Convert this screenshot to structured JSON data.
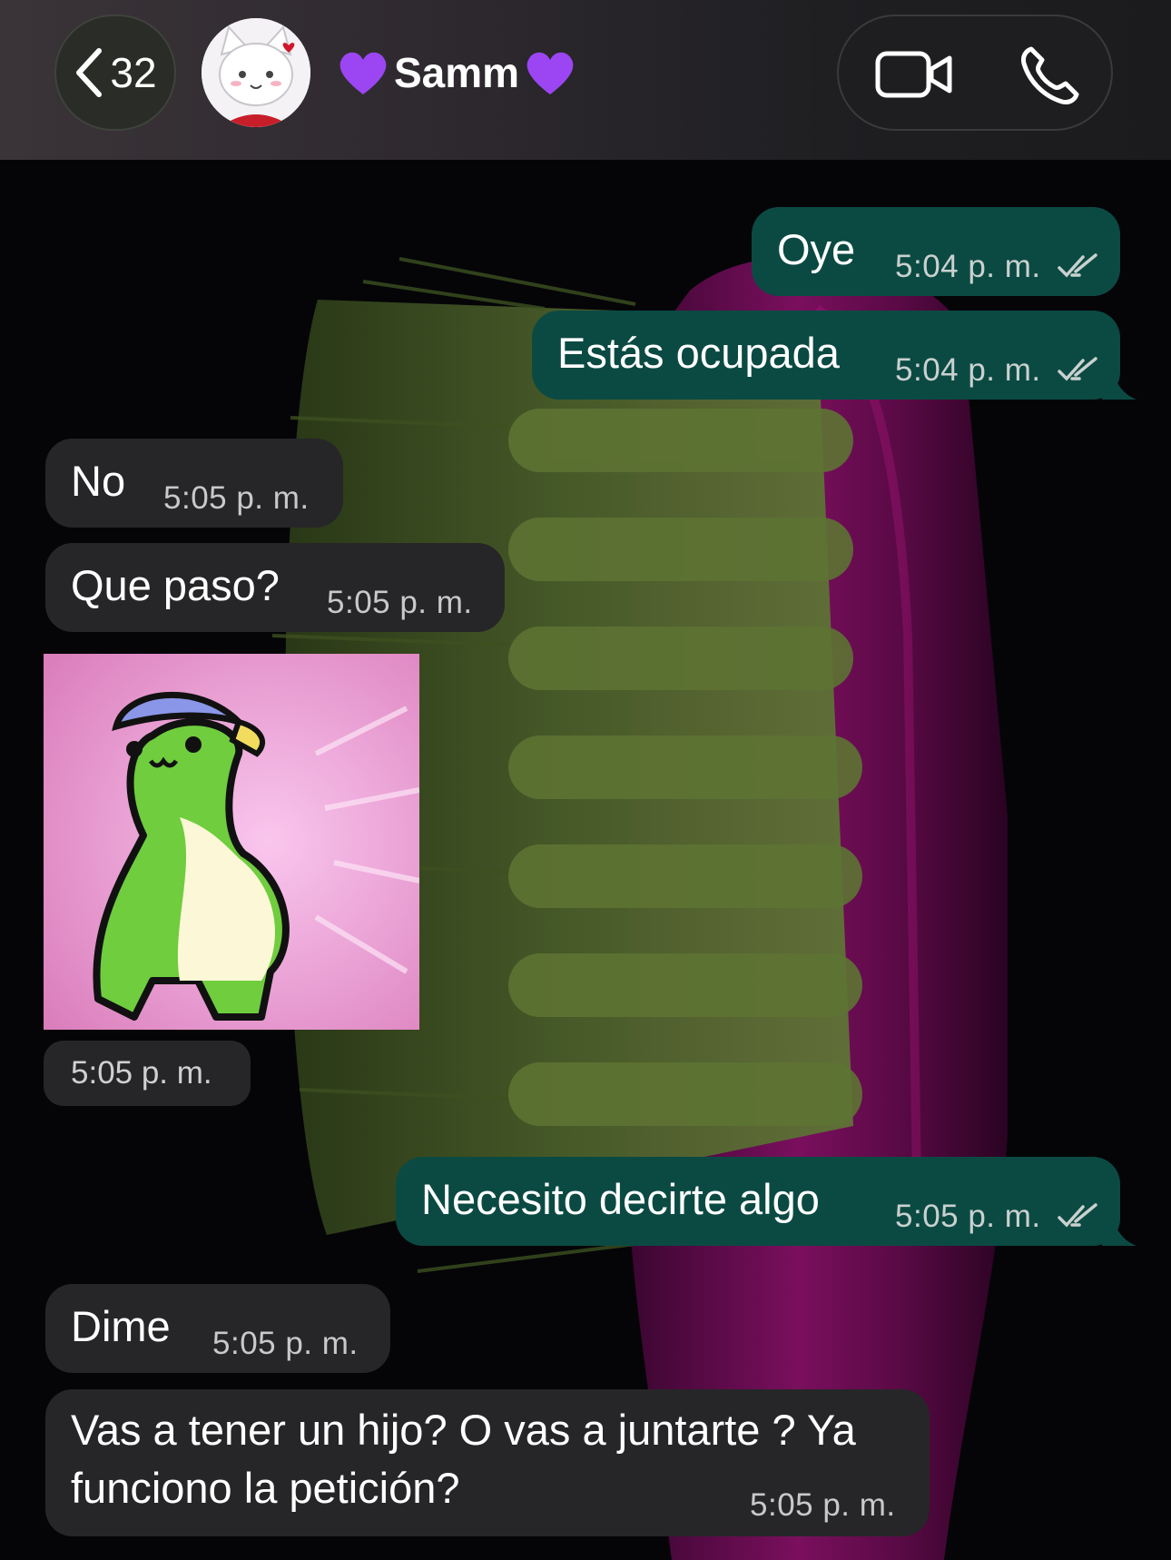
{
  "colors": {
    "outgoing_bubble": "#0b4a43",
    "incoming_bubble": "#262628",
    "background": "#050508",
    "read_ticks": "#c9d1cf"
  },
  "header": {
    "back_icon": "chevron-left-icon",
    "unread_count": "32",
    "contact_name": "Samm",
    "name_decoration_icon": "purple-heart-icon",
    "video_call_icon": "video-camera-icon",
    "voice_call_icon": "phone-icon"
  },
  "messages": [
    {
      "direction": "out",
      "text": "Oye",
      "time": "5:04 p. m.",
      "status_icon": "double-check-icon"
    },
    {
      "direction": "out",
      "text": "Estás ocupada",
      "time": "5:04 p. m.",
      "status_icon": "double-check-icon"
    },
    {
      "direction": "in",
      "text": "No",
      "time": "5:05 p. m."
    },
    {
      "direction": "in",
      "text": "Que paso?",
      "time": "5:05 p. m."
    },
    {
      "direction": "in",
      "type": "sticker",
      "sticker": "green-dinosaur-sticker",
      "time": "5:05 p. m."
    },
    {
      "direction": "out",
      "text": "Necesito decirte algo",
      "time": "5:05 p. m.",
      "status_icon": "double-check-icon"
    },
    {
      "direction": "in",
      "text": "Dime",
      "time": "5:05 p. m."
    },
    {
      "direction": "in",
      "text_line1": "Vas a tener un hijo? O vas a juntarte ? Ya",
      "text_line2": "funciono la petición?",
      "time": "5:05 p. m."
    }
  ]
}
